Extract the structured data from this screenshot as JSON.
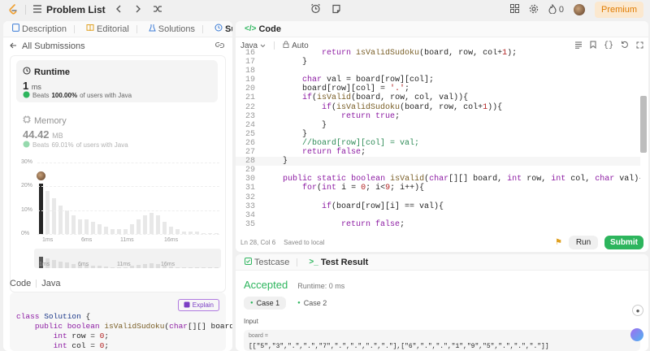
{
  "topbar": {
    "problem_list": "Problem List",
    "streak": "0",
    "premium": "Premium"
  },
  "left_tabs": [
    {
      "label": "Description"
    },
    {
      "label": "Editorial"
    },
    {
      "label": "Solutions"
    },
    {
      "label": "Submissions"
    }
  ],
  "submissions": {
    "back_label": "All Submissions"
  },
  "runtime": {
    "label": "Runtime",
    "value": "1",
    "unit": "ms",
    "beats_prefix": "Beats",
    "beats_pct": "100.00%",
    "beats_suffix": "of users with Java"
  },
  "memory": {
    "label": "Memory",
    "value": "44.42",
    "unit": "MB",
    "beats_prefix": "Beats",
    "beats_pct": "69.01%",
    "beats_suffix": "of users with Java"
  },
  "chart_data": {
    "type": "bar",
    "y_ticks": [
      "30%",
      "20%",
      "10%",
      "0%"
    ],
    "x_ticks": [
      "1ms",
      "6ms",
      "11ms",
      "16ms"
    ],
    "values": [
      21,
      18,
      15,
      12,
      10,
      8,
      6,
      6,
      5,
      4,
      3,
      2,
      2,
      2,
      4,
      6,
      8,
      9,
      8,
      5,
      3,
      2,
      1,
      1,
      1,
      0.5,
      0.5,
      0.5
    ],
    "highlight_index": 0
  },
  "code_section": {
    "title": "Code",
    "language": "Java",
    "explain_label": "Explain",
    "lines": [
      "class Solution {",
      "    public boolean isValidSudoku(char[][] board) {",
      "        int row = 0;",
      "        int col = 0;"
    ]
  },
  "editor": {
    "tab_label": "Code",
    "language": "Java",
    "mode": "Auto",
    "lines": [
      {
        "n": "16",
        "t": "            return isValidSudoku(board, row, col+1);"
      },
      {
        "n": "17",
        "t": "        }"
      },
      {
        "n": "18",
        "t": ""
      },
      {
        "n": "19",
        "t": "        char val = board[row][col];"
      },
      {
        "n": "20",
        "t": "        board[row][col] = '.';"
      },
      {
        "n": "21",
        "t": "        if(isValid(board, row, col, val)){"
      },
      {
        "n": "22",
        "t": "            if(isValidSudoku(board, row, col+1)){"
      },
      {
        "n": "23",
        "t": "                return true;"
      },
      {
        "n": "24",
        "t": "            }"
      },
      {
        "n": "25",
        "t": "        }"
      },
      {
        "n": "26",
        "t": "        //board[row][col] = val;"
      },
      {
        "n": "27",
        "t": "        return false;"
      },
      {
        "n": "28",
        "t": "    }"
      },
      {
        "n": "29",
        "t": ""
      },
      {
        "n": "30",
        "t": "    public static boolean isValid(char[][] board, int row, int col, char val){"
      },
      {
        "n": "31",
        "t": "        for(int i = 0; i<9; i++){"
      },
      {
        "n": "32",
        "t": ""
      },
      {
        "n": "33",
        "t": "            if(board[row][i] == val){"
      },
      {
        "n": "34",
        "t": ""
      },
      {
        "n": "35",
        "t": "                return false;"
      }
    ],
    "status_position": "Ln 28, Col 6",
    "status_saved": "Saved to local",
    "run_label": "Run",
    "submit_label": "Submit"
  },
  "result": {
    "testcase_tab": "Testcase",
    "result_tab": "Test Result",
    "status": "Accepted",
    "runtime_text": "Runtime: 0 ms",
    "cases": [
      "Case 1",
      "Case 2"
    ],
    "input_label": "Input",
    "var_label": "board =",
    "var_value": "[[\"5\",\"3\",\".\",\".\",\"7\",\".\",\".\",\".\",\".\"],[\"6\",\".\",\".\",\"1\",\"9\",\"5\",\".\",\".\",\".\"]]"
  },
  "colors": {
    "accent_green": "#2db55d",
    "premium_bg": "#fbe8cf",
    "premium_fg": "#e07b00",
    "bar_dark": "#262626",
    "bar_light": "#e8e8e8"
  }
}
